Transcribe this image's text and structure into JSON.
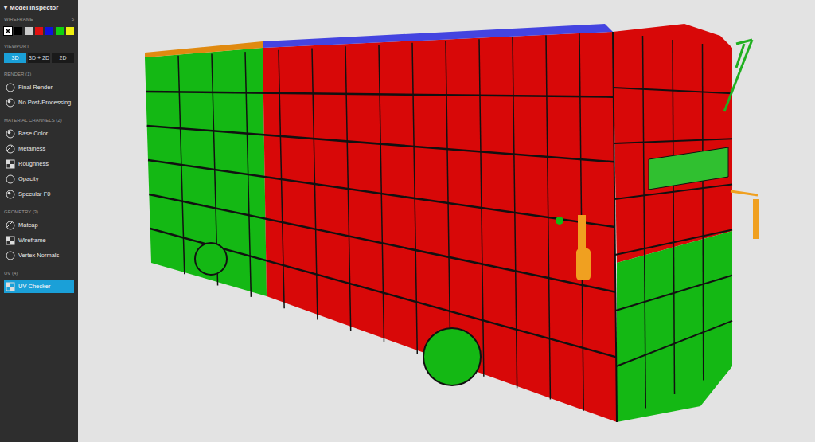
{
  "sidebar": {
    "title": "Model Inspector",
    "collapse_glyph": "▾",
    "wireframe": {
      "label": "WIREFRAME",
      "value": "5",
      "swatches": [
        {
          "color": "#ffffff",
          "selected": true,
          "none": true
        },
        {
          "color": "#000000",
          "selected": false,
          "none": false
        },
        {
          "color": "#cccccc",
          "selected": false,
          "none": false
        },
        {
          "color": "#e01010",
          "selected": false,
          "none": false
        },
        {
          "color": "#1010e0",
          "selected": false,
          "none": false
        },
        {
          "color": "#10d010",
          "selected": false,
          "none": false
        },
        {
          "color": "#f0f010",
          "selected": false,
          "none": false
        }
      ]
    },
    "viewport": {
      "label": "VIEWPORT",
      "buttons": [
        {
          "label": "3D",
          "selected": true
        },
        {
          "label": "3D + 2D",
          "selected": false
        },
        {
          "label": "2D",
          "selected": false
        }
      ]
    },
    "sections": [
      {
        "label": "RENDER (1)",
        "items": [
          {
            "label": "Final Render",
            "selected": false
          },
          {
            "label": "No Post-Processing",
            "selected": false
          }
        ]
      },
      {
        "label": "MATERIAL CHANNELS (2)",
        "items": [
          {
            "label": "Base Color",
            "selected": false
          },
          {
            "label": "Metalness",
            "selected": false
          },
          {
            "label": "Roughness",
            "selected": false
          },
          {
            "label": "Opacity",
            "selected": false
          },
          {
            "label": "Specular F0",
            "selected": false
          }
        ]
      },
      {
        "label": "GEOMETRY (3)",
        "items": [
          {
            "label": "Matcap",
            "selected": false
          },
          {
            "label": "Wireframe",
            "selected": false
          },
          {
            "label": "Vertex Normals",
            "selected": false
          }
        ]
      },
      {
        "label": "UV (4)",
        "items": [
          {
            "label": "UV Checker",
            "selected": true
          }
        ]
      }
    ]
  }
}
